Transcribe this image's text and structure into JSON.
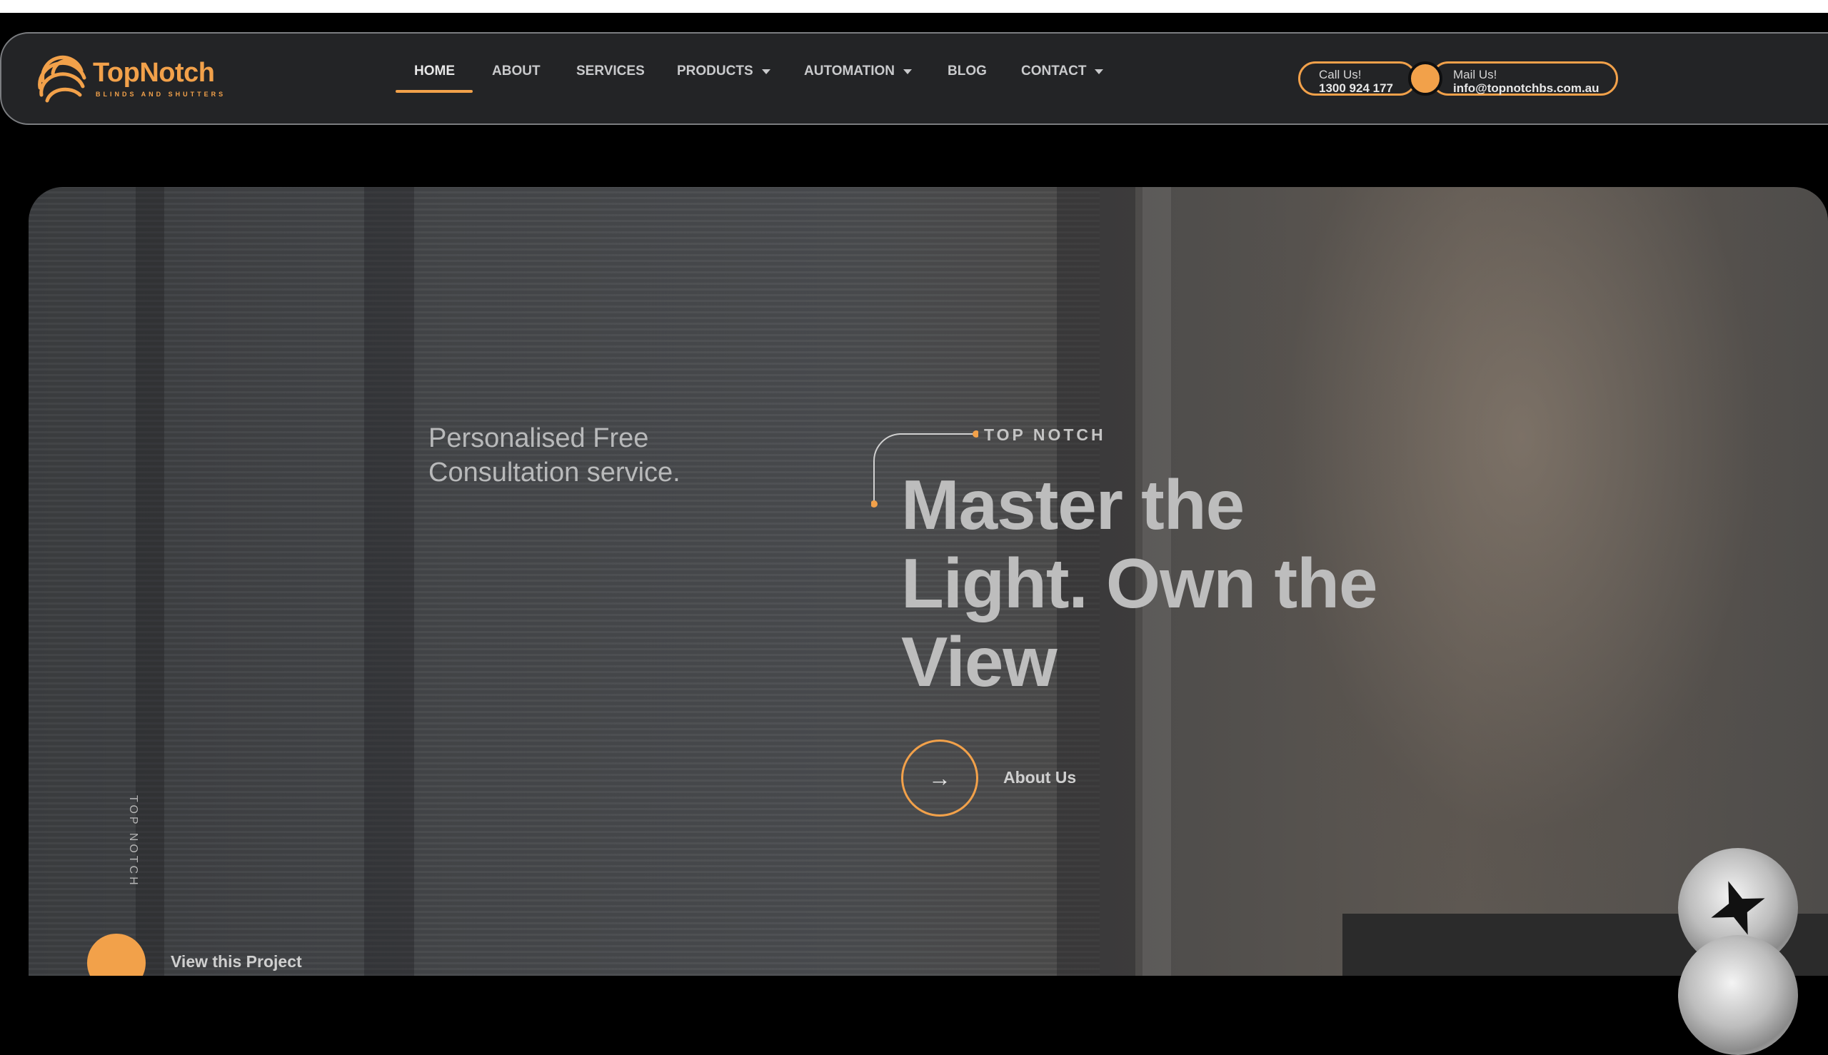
{
  "brand": {
    "name": "TopNotch",
    "tagline": "BLINDS AND SHUTTERS",
    "accent": "#f2a14a"
  },
  "nav": {
    "items": [
      {
        "label": "HOME",
        "active": true
      },
      {
        "label": "ABOUT"
      },
      {
        "label": "SERVICES"
      },
      {
        "label": "PRODUCTS",
        "dropdown": true
      },
      {
        "label": "AUTOMATION",
        "dropdown": true
      },
      {
        "label": "BLOG"
      },
      {
        "label": "CONTACT",
        "dropdown": true
      }
    ]
  },
  "contact": {
    "call_label": "Call Us!",
    "call_value": "1300 924 177",
    "mail_label": "Mail Us!",
    "mail_value": "info@topnotchbs.com.au"
  },
  "hero": {
    "subtitle_line1": "Personalised Free",
    "subtitle_line2": "Consultation service.",
    "eyebrow": "TOP NOTCH",
    "headline_line1": "Master the",
    "headline_line2": "Light. Own the",
    "headline_line3": "View",
    "about_button": "About Us",
    "vertical_label": "TOP NOTCH",
    "view_project": "View this Project"
  }
}
